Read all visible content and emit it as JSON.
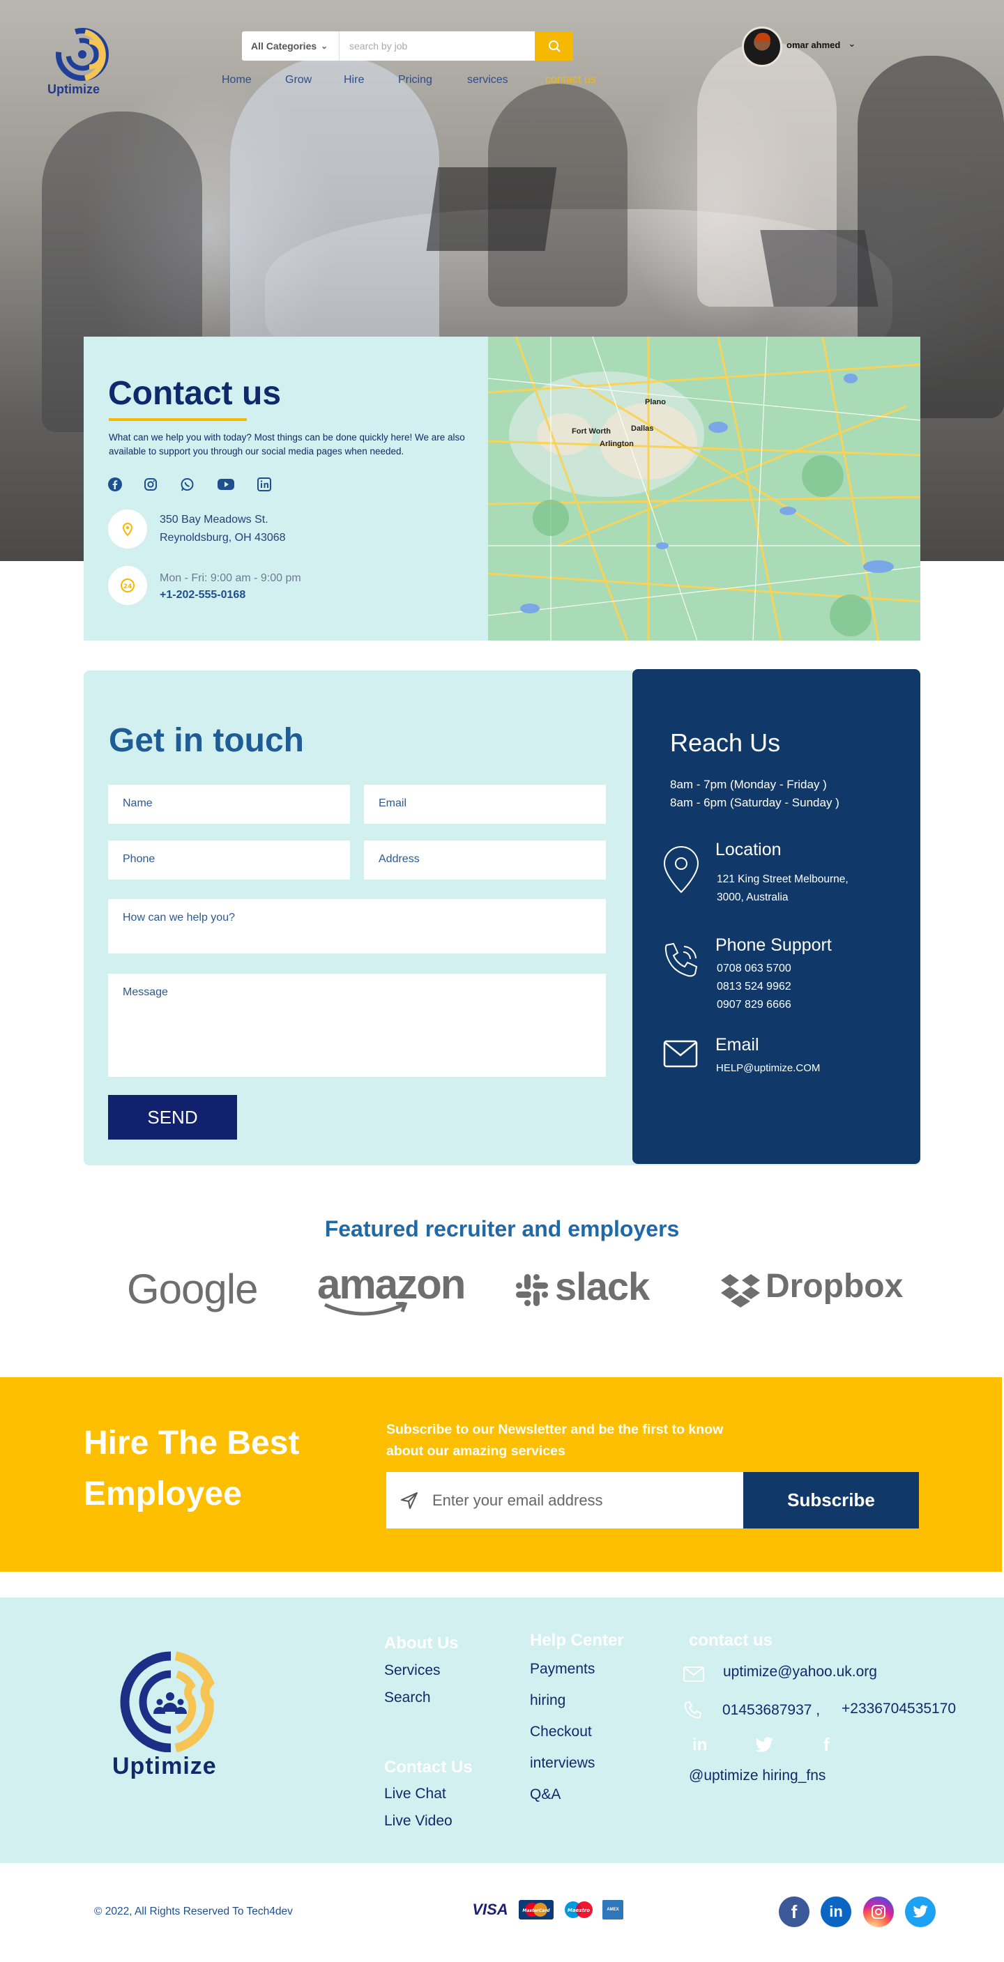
{
  "header": {
    "logo_text": "Uptimize",
    "search": {
      "category": "All Categories",
      "placeholder": "search by job"
    },
    "nav": [
      "Home",
      "Grow",
      "Hire",
      "Pricing",
      "services",
      "contact us"
    ],
    "user": {
      "name": "omar ahmed"
    }
  },
  "contact": {
    "title": "Contact us",
    "description": "What can we help you with today? Most things can be done quickly here! We are also available to support you through our social media pages when needed.",
    "social_icons": [
      "facebook-icon",
      "instagram-icon",
      "whatsapp-icon",
      "youtube-icon",
      "linkedin-icon"
    ],
    "address_line1": "350 Bay Meadows St.",
    "address_line2": "Reynoldsburg, OH 43068",
    "hours": "Mon - Fri: 9:00 am - 9:00 pm",
    "phone": "+1-202-555-0168",
    "map_labels": [
      "Fort Worth",
      "Dallas",
      "Arlington",
      "Plano"
    ]
  },
  "get_in_touch": {
    "title": "Get in touch",
    "fields": {
      "name": "Name",
      "email": "Email",
      "phone": "Phone",
      "address": "Address",
      "help": "How can we help you?",
      "message": "Message"
    },
    "send_label": "SEND"
  },
  "reach_us": {
    "title": "Reach Us",
    "hours_line1": "8am - 7pm (Monday - Friday )",
    "hours_line2": "8am - 6pm (Saturday - Sunday )",
    "location_title": "Location",
    "location_line1": "121 King Street Melbourne,",
    "location_line2": "3000, Australia",
    "phone_title": "Phone Support",
    "phones": [
      "0708 063 5700",
      "0813 524 9962",
      "0907 829 6666"
    ],
    "email_title": "Email",
    "email": "HELP@uptimize.COM"
  },
  "featured": {
    "title": "Featured recruiter and employers",
    "brands": [
      "Google",
      "amazon",
      "slack",
      "Dropbox"
    ]
  },
  "newsletter": {
    "title": "Hire The Best Employee",
    "subtitle": "Subscribe to our Newsletter and be the first to know about  our amazing services",
    "placeholder": "Enter your email address",
    "button": "Subscribe"
  },
  "footer": {
    "logo_text": "Uptimize",
    "about_title": "About Us",
    "about_links": [
      "Services",
      "Search"
    ],
    "contact_title": "Contact Us",
    "contact_links": [
      "Live Chat",
      "Live Video"
    ],
    "help_title": "Help Center",
    "help_links": [
      "Payments",
      "hiring",
      "Checkout",
      "interviews",
      "Q&A"
    ],
    "contact_us_title": "contact us",
    "email": "uptimize@yahoo.uk.org",
    "phone1": "01453687937 ,",
    "phone2": "+2336704535170",
    "handle": "@uptimize hiring_fns"
  },
  "bottom": {
    "copyright": "© 2022, All Rights Reserved To Tech4dev",
    "payments": [
      "VISA",
      "MasterCard",
      "Maestro",
      "AMEX"
    ]
  },
  "colors": {
    "navy": "#0f2a6b",
    "dark_blue": "#10396a",
    "accent_yellow": "#fdbf00",
    "light_teal": "#d2f0f0"
  }
}
